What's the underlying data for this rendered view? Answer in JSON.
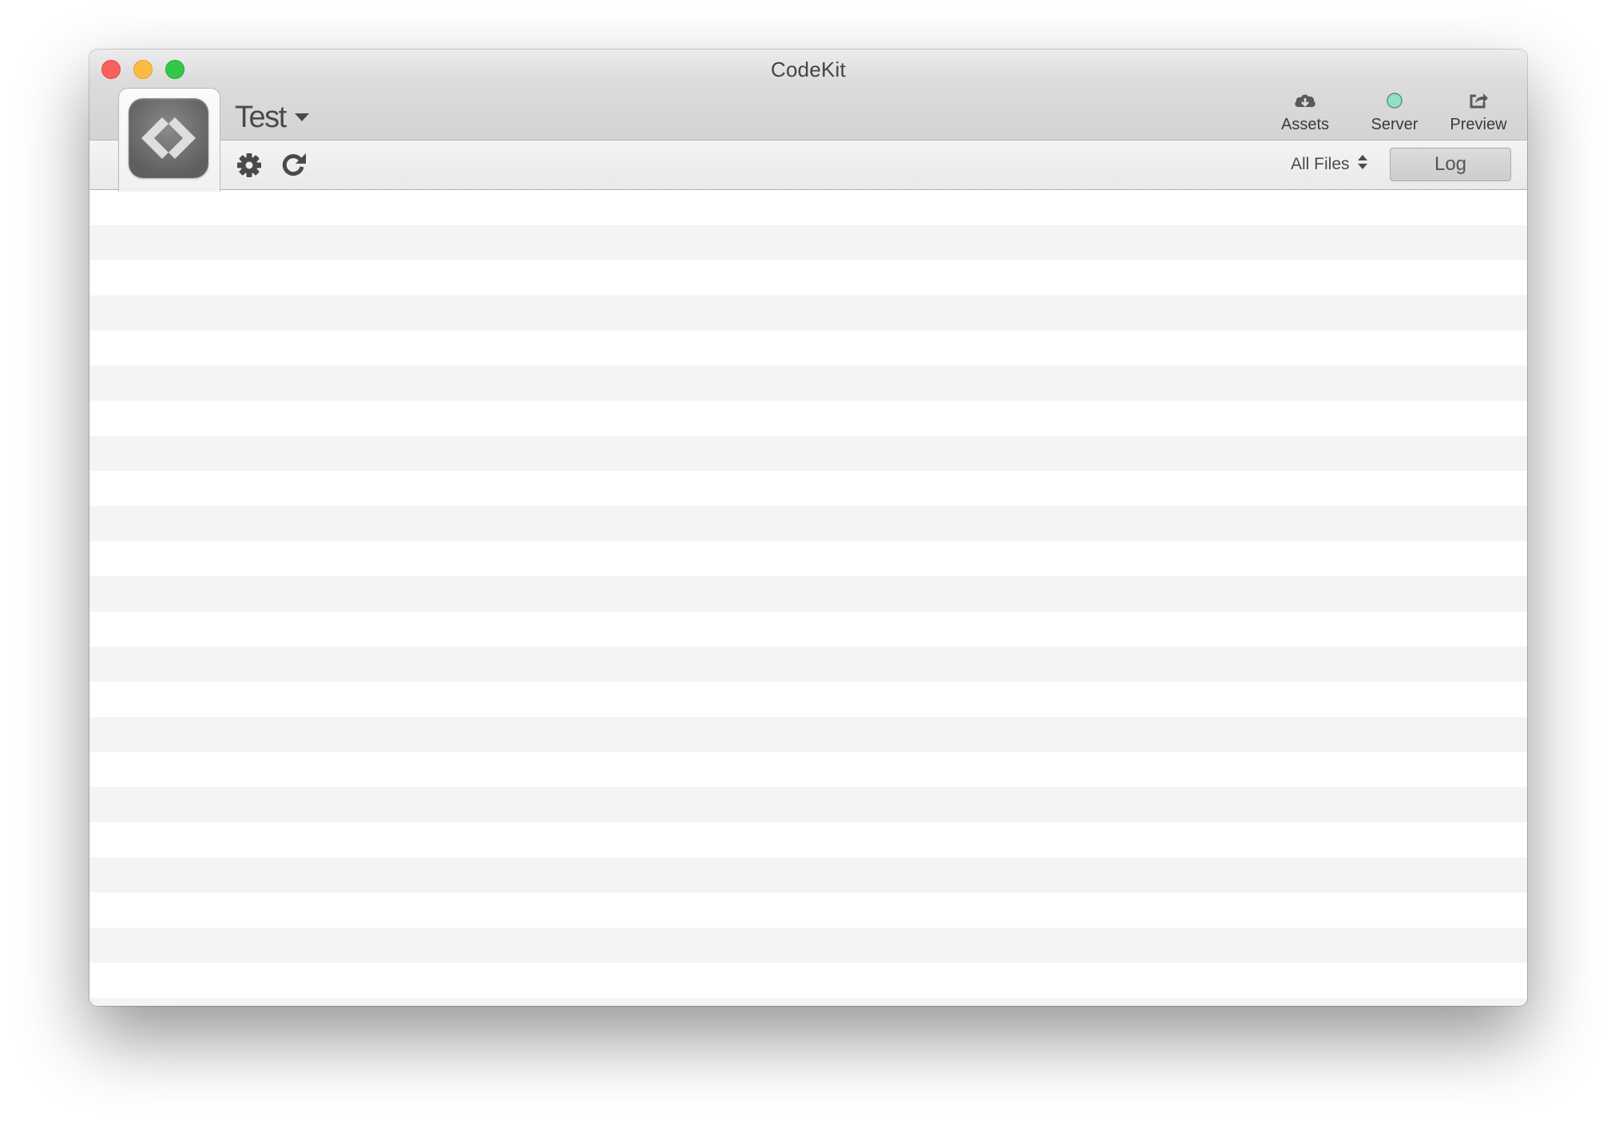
{
  "window": {
    "title": "CodeKit"
  },
  "project": {
    "name": "Test"
  },
  "toolbar": {
    "assets_label": "Assets",
    "server_label": "Server",
    "preview_label": "Preview",
    "server_status_color": "#8fe2c4",
    "file_filter": "All Files",
    "log_label": "Log"
  },
  "icons": {
    "close": "close-button",
    "minimize": "minimize-button",
    "zoom": "zoom-button",
    "logo": "codekit-logo-icon",
    "project_dropdown": "caret-down-icon",
    "assets": "cloud-download-icon",
    "server": "status-dot-icon",
    "preview": "share-icon",
    "settings": "gear-icon",
    "refresh": "refresh-icon",
    "filter_arrows": "up-down-arrows-icon"
  },
  "colors": {
    "close": "#fc605c",
    "minimize": "#fdbc40",
    "zoom": "#34c84a",
    "row_alt": "#f4f4f4"
  },
  "file_list": {
    "rows": []
  }
}
